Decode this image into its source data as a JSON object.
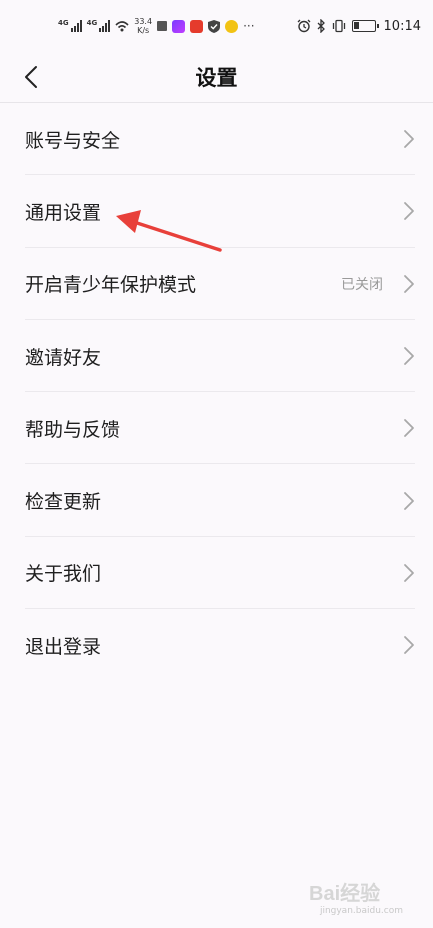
{
  "status_bar": {
    "net1": "4G",
    "net2": "4G",
    "speed_value": "33.4",
    "speed_unit": "K/s",
    "time": "10:14",
    "battery_level_pct": 30
  },
  "header": {
    "title": "设置"
  },
  "settings": {
    "items": [
      {
        "label": "账号与安全",
        "value": ""
      },
      {
        "label": "通用设置",
        "value": ""
      },
      {
        "label": "开启青少年保护模式",
        "value": "已关闭"
      },
      {
        "label": "邀请好友",
        "value": ""
      },
      {
        "label": "帮助与反馈",
        "value": ""
      },
      {
        "label": "检查更新",
        "value": ""
      },
      {
        "label": "关于我们",
        "value": ""
      },
      {
        "label": "退出登录",
        "value": ""
      }
    ]
  },
  "icons": {
    "back": "chevron-left-icon",
    "row_arrow": "chevron-right-icon"
  },
  "colors": {
    "background": "#fbf9fc",
    "annotation_arrow": "#e8403a",
    "secondary_text": "#9a9a9a"
  },
  "watermark": {
    "text": "Bai经验",
    "sub": "jingyan.baidu.com"
  }
}
